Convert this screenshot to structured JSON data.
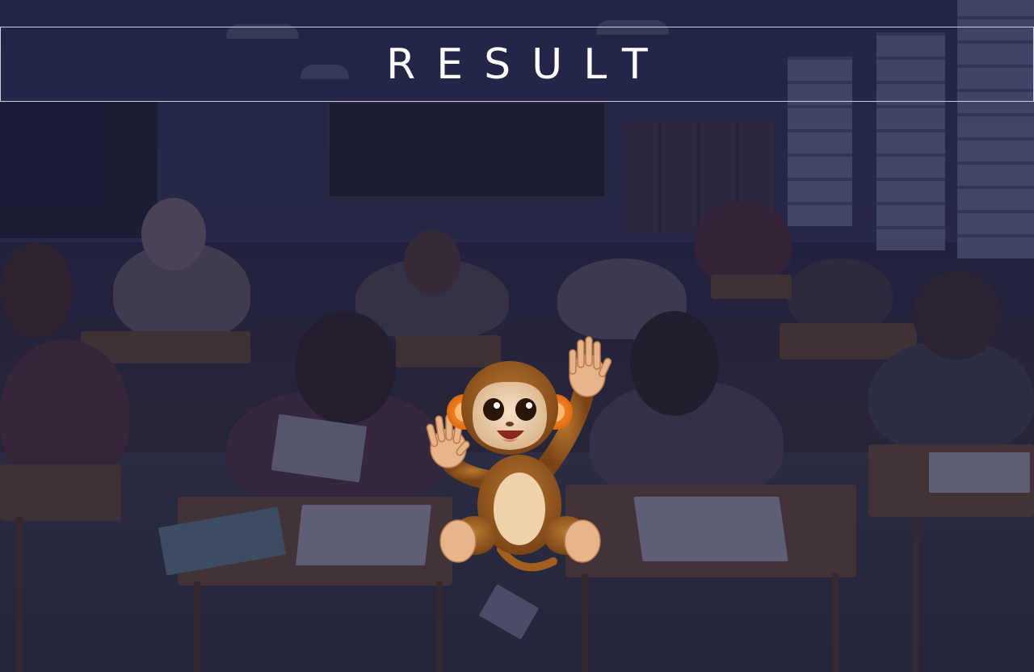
{
  "header": {
    "title": "RESULT"
  },
  "mascot": {
    "icon": "waving-monkey-icon"
  },
  "background": {
    "icon": "classroom-image",
    "overlay_color": "#141640"
  }
}
